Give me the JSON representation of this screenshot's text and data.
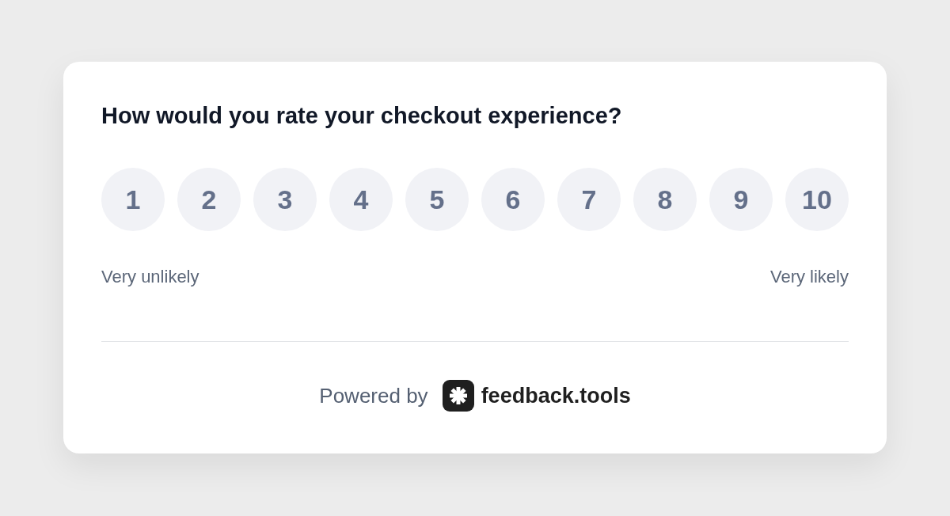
{
  "survey": {
    "question": "How would you rate your checkout experience?",
    "scale": [
      {
        "label": "1",
        "selected": false
      },
      {
        "label": "2",
        "selected": false
      },
      {
        "label": "3",
        "selected": false
      },
      {
        "label": "4",
        "selected": false
      },
      {
        "label": "5",
        "selected": false
      },
      {
        "label": "6",
        "selected": false
      },
      {
        "label": "7",
        "selected": false
      },
      {
        "label": "8",
        "selected": false
      },
      {
        "label": "9",
        "selected": false
      },
      {
        "label": "10",
        "selected": false
      }
    ],
    "low_label": "Very unlikely",
    "high_label": "Very likely"
  },
  "footer": {
    "powered_by": "Powered by",
    "brand": "feedback.tools"
  }
}
